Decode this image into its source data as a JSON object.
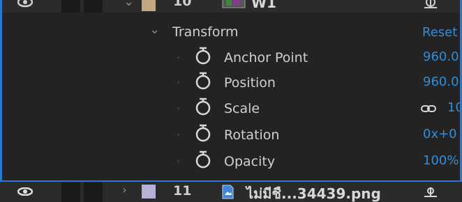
{
  "colors": {
    "panel_bg": "#232323",
    "value_blue": "#2f8fdc",
    "selection_blue": "#2a78d2",
    "label_tan": "#c2a880",
    "label_lavender": "#b7b1d8"
  },
  "layer_above": {
    "number": "10",
    "name": "W1",
    "icons": {
      "visibility": "eye-icon",
      "twirl": "chevron-down-icon",
      "source": "composition-icon",
      "parent": "parent-pickwhip-icon"
    }
  },
  "transform": {
    "group_label": "Transform",
    "reset_label": "Reset",
    "properties": [
      {
        "name": "Anchor Point",
        "value": "960.0"
      },
      {
        "name": "Position",
        "value": "960.0"
      },
      {
        "name": "Scale",
        "value": "10",
        "linked": true
      },
      {
        "name": "Rotation",
        "value": "0x+0"
      },
      {
        "name": "Opacity",
        "value": "100%"
      }
    ]
  },
  "layer_below": {
    "number": "11",
    "name": "ไม่มีชื...34439.png",
    "icons": {
      "visibility": "eye-icon",
      "twirl": "chevron-right-icon",
      "source": "image-file-icon",
      "parent": "parent-pickwhip-icon"
    }
  }
}
